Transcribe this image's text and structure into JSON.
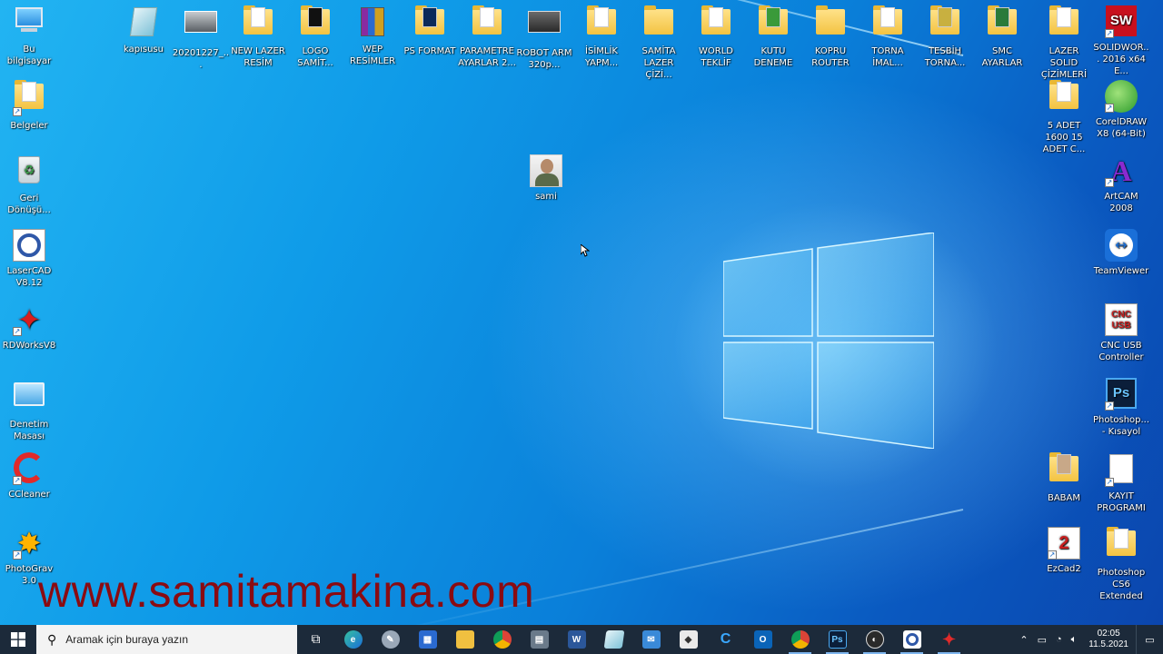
{
  "desktop": {
    "watermark": "www.samitamakina.com",
    "icons": {
      "bu_bilgisayar": "Bu bilgisayar",
      "belgeler": "Belgeler",
      "geri_donusum": "Geri Dönüşü...",
      "lasercad": "LaserCAD V8.12",
      "rdworks": "RDWorksV8",
      "denetim": "Denetim Masası",
      "ccleaner": "CCleaner",
      "photograv": "PhotoGrav 3.0",
      "kapisusu": "kapısusu",
      "file_2020": "20201227_...",
      "new_lazer": "NEW LAZER RESİM",
      "logo_samit": "LOGO SAMİT...",
      "wep": "WEP RESİMLER",
      "ps_format": "PS FORMAT",
      "parametre": "PARAMETRE AYARLAR 2...",
      "robot": "ROBOT ARM 320p...",
      "isimlik": "İSİMLİK YAPM...",
      "samita_lazer": "SAMİTA LAZER ÇİZİ...",
      "world": "WORLD TEKLİF",
      "kutu": "KUTU DENEME",
      "kopru": "KOPRU ROUTER",
      "torna": "TORNA İMAL...",
      "tesbih": "TESBİH TORNA...",
      "smc": "SMC AYARLAR",
      "lazer_solid": "LAZER SOLID ÇİZİMLERİ",
      "solidworks": "SOLIDWOR... 2016 x64 E...",
      "adet": "5 ADET 1600 15 ADET C...",
      "coreldraw": "CorelDRAW X8 (64-Bit)",
      "artcam": "ArtCAM 2008",
      "teamviewer": "TeamViewer",
      "cnc_usb": "CNC USB Controller",
      "photoshop_kisayol": "Photoshop... - Kısayol",
      "babam": "BABAM",
      "kayit": "KAYIT PROGRAMI",
      "ezcad": "EzCad2",
      "photoshop_cs6": "Photoshop CS6 Extended",
      "sami": "sami"
    }
  },
  "taskbar": {
    "search_placeholder": "Aramak için buraya yazın",
    "clock_time": "02:05",
    "clock_date": "11.5.2021"
  }
}
